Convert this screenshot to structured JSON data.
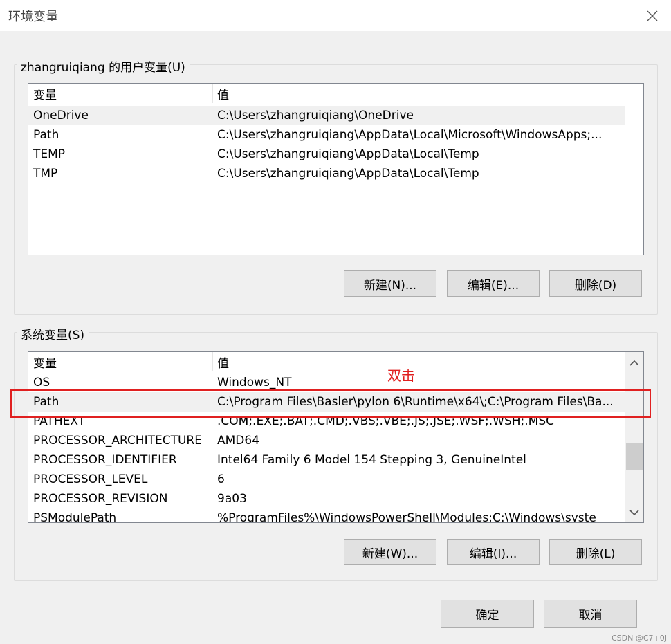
{
  "window": {
    "title": "环境变量",
    "close_icon": "close-icon"
  },
  "user_group": {
    "label": "zhangruiqiang 的用户变量(U)",
    "columns": [
      "变量",
      "值"
    ],
    "rows": [
      {
        "name": "OneDrive",
        "value": "C:\\Users\\zhangruiqiang\\OneDrive"
      },
      {
        "name": "Path",
        "value": "C:\\Users\\zhangruiqiang\\AppData\\Local\\Microsoft\\WindowsApps;..."
      },
      {
        "name": "TEMP",
        "value": "C:\\Users\\zhangruiqiang\\AppData\\Local\\Temp"
      },
      {
        "name": "TMP",
        "value": "C:\\Users\\zhangruiqiang\\AppData\\Local\\Temp"
      }
    ],
    "buttons": {
      "new": "新建(N)...",
      "edit": "编辑(E)...",
      "delete": "删除(D)"
    }
  },
  "system_group": {
    "label": "系统变量(S)",
    "columns": [
      "变量",
      "值"
    ],
    "rows": [
      {
        "name": "OS",
        "value": "Windows_NT"
      },
      {
        "name": "Path",
        "value": "C:\\Program Files\\Basler\\pylon 6\\Runtime\\x64\\;C:\\Program Files\\Ba..."
      },
      {
        "name": "PATHEXT",
        "value": ".COM;.EXE;.BAT;.CMD;.VBS;.VBE;.JS;.JSE;.WSF;.WSH;.MSC"
      },
      {
        "name": "PROCESSOR_ARCHITECTURE",
        "value": "AMD64"
      },
      {
        "name": "PROCESSOR_IDENTIFIER",
        "value": "Intel64 Family 6 Model 154 Stepping 3, GenuineIntel"
      },
      {
        "name": "PROCESSOR_LEVEL",
        "value": "6"
      },
      {
        "name": "PROCESSOR_REVISION",
        "value": "9a03"
      },
      {
        "name": "PSModulePath",
        "value": "%ProgramFiles%\\WindowsPowerShell\\Modules;C:\\Windows\\syste"
      }
    ],
    "buttons": {
      "new": "新建(W)...",
      "edit": "编辑(I)...",
      "delete": "删除(L)"
    }
  },
  "annotation": {
    "text": "双击",
    "color": "#e02020"
  },
  "footer": {
    "ok": "确定",
    "cancel": "取消"
  },
  "watermark": "CSDN @C7+0J"
}
